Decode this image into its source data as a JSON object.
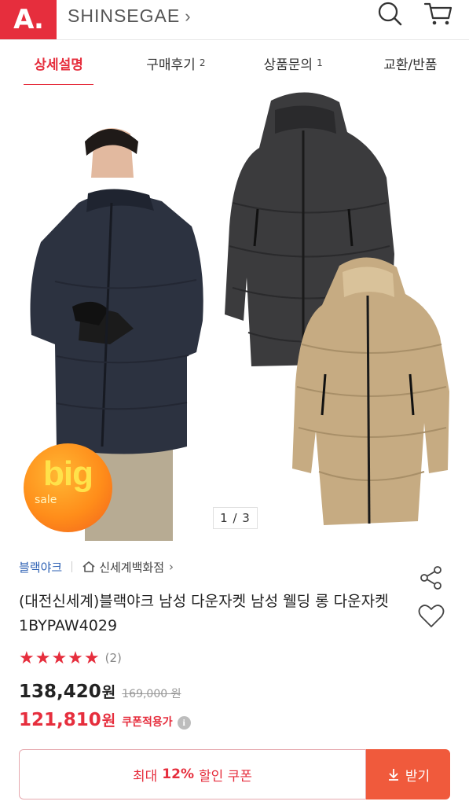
{
  "header": {
    "logo_text": "A.",
    "brand": "SHINSEGAE",
    "brand_chevron": "›",
    "search_icon": "search-icon",
    "cart_icon": "cart-icon"
  },
  "tabs": [
    {
      "label": "상세설명",
      "count": "",
      "active": true
    },
    {
      "label": "구매후기",
      "count": "2",
      "active": false
    },
    {
      "label": "상품문의",
      "count": "1",
      "active": false
    },
    {
      "label": "교환/반품",
      "count": "",
      "active": false
    }
  ],
  "gallery": {
    "pager": "1 / 3",
    "badge_big": "big",
    "badge_sale": "sale"
  },
  "product": {
    "brand": "블랙야크",
    "store": "신세계백화점",
    "store_chevron": "›",
    "title": "(대전신세계)블랙야크 남성 다운자켓 남성 웰딩 롱 다운자켓 1BYPAW4029",
    "stars": "★★★★★",
    "rating_value": 5,
    "review_count": "(2)",
    "price": "138,420",
    "price_unit": "원",
    "original_price": "169,000 원",
    "sale_price": "121,810",
    "sale_unit": "원",
    "coupon_note": "쿠폰적용가",
    "info_icon": "i"
  },
  "coupon": {
    "prefix": "최대",
    "percent": "12%",
    "suffix": "할인 쿠폰",
    "button": "받기"
  },
  "colors": {
    "accent": "#e62e3d",
    "brand_link": "#2b5fb3",
    "button": "#f05a3c"
  }
}
